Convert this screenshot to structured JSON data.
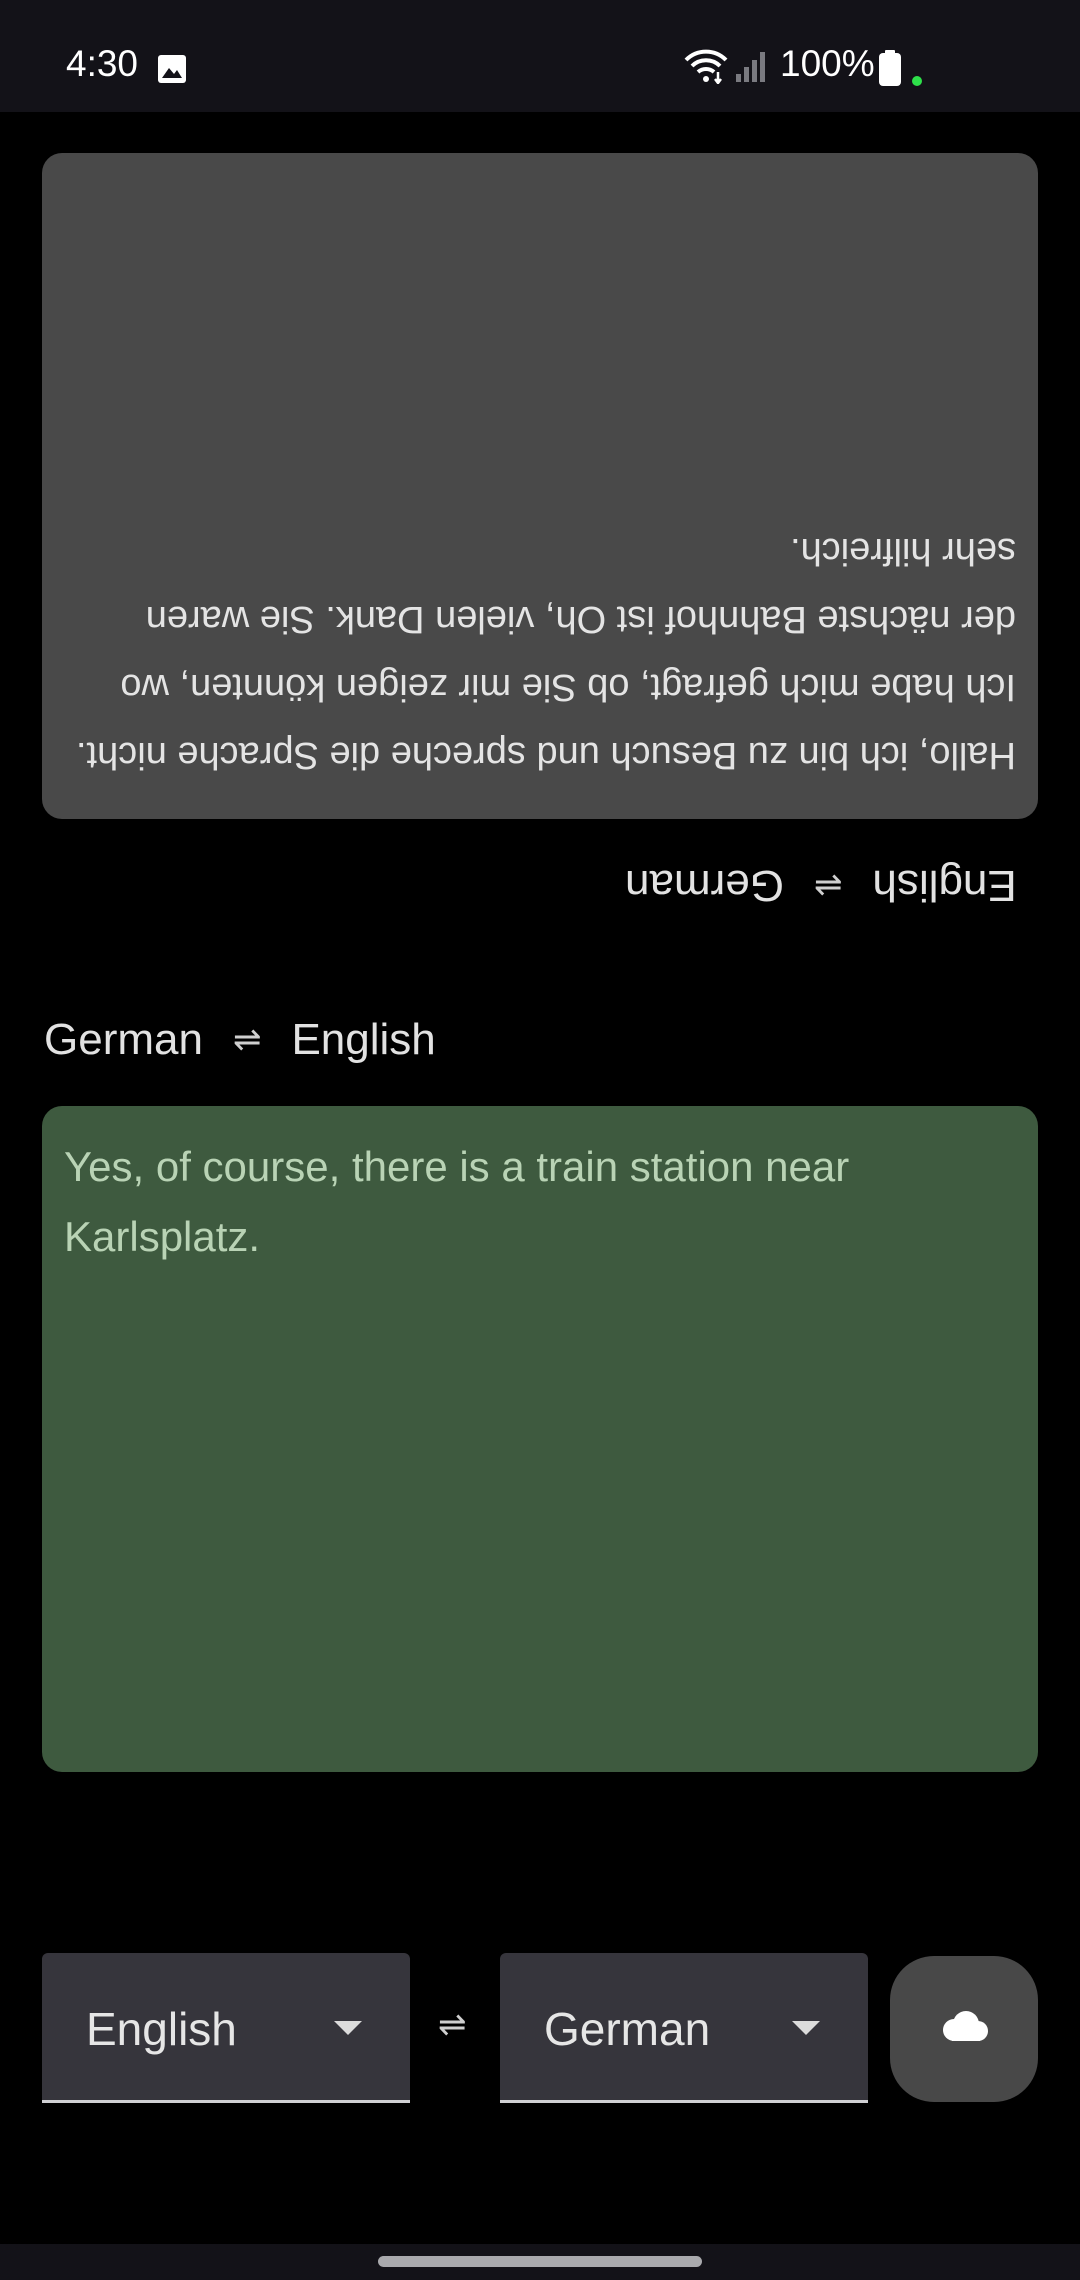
{
  "status_bar": {
    "time": "4:30",
    "battery_percent": "100%",
    "icons": [
      "gallery-icon",
      "wifi-icon",
      "signal-icon",
      "battery-icon"
    ],
    "dot_color": "#2ee04a"
  },
  "upper_panel": {
    "text": "Hallo, ich bin zu Besuch und spreche die Sprache nicht. Ich habe mich gefragt, ob Sie mir zeigen könnten, wo der nächste Bahnhof ist Oh, vielen Dank. Sie waren sehr hilfreich.",
    "background": "#494949",
    "orientation": "upside-down"
  },
  "upper_pair": {
    "source": "English",
    "swap": "⇌",
    "target": "German"
  },
  "lower_pair": {
    "source": "German",
    "swap": "⇌",
    "target": "English"
  },
  "lower_panel": {
    "text": "Yes, of course, there is a train station near Karlsplatz.",
    "background": "#3e5a3f"
  },
  "controls": {
    "source_language": "English",
    "swap": "⇌",
    "target_language": "German",
    "action_icon": "cloud-icon"
  }
}
